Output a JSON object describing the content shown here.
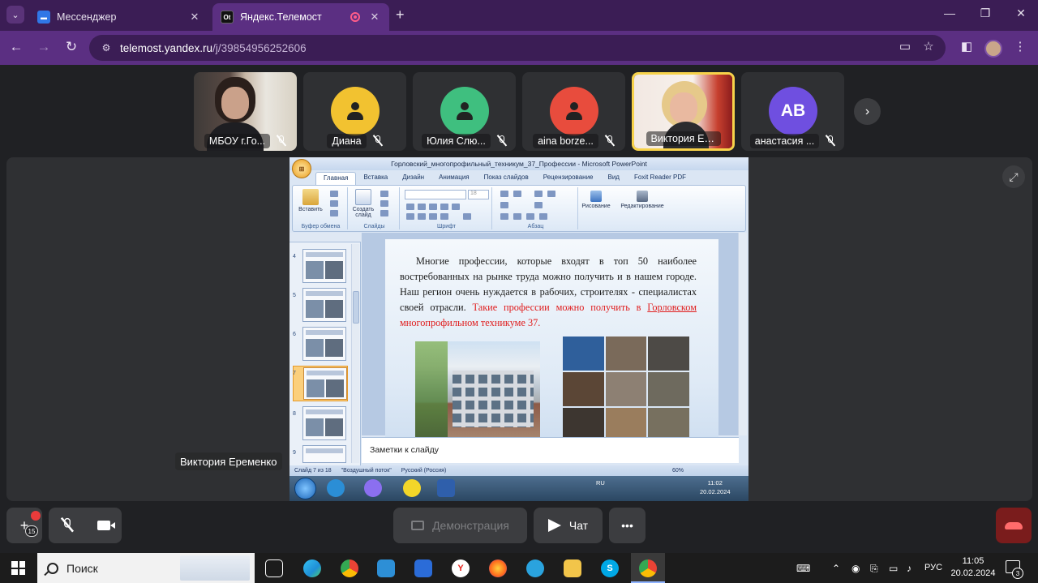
{
  "browser": {
    "tabs": [
      {
        "title": "Мессенджер",
        "active": false
      },
      {
        "title": "Яндекс.Телемост",
        "active": true
      }
    ],
    "url_host": "telemost.yandex.ru",
    "url_path": "/j/39854956252606"
  },
  "participants": [
    {
      "name": "МБОУ г.Го...",
      "kind": "video",
      "muted": true
    },
    {
      "name": "Диана",
      "kind": "avatar",
      "color": "#f2c230",
      "muted": true
    },
    {
      "name": "Юлия Слю...",
      "kind": "avatar",
      "color": "#3fbf7f",
      "muted": true
    },
    {
      "name": "aina borze...",
      "kind": "avatar",
      "color": "#e84c3d",
      "muted": true
    },
    {
      "name": "Виктория Ер...",
      "kind": "video",
      "speaking": true,
      "muted": false
    },
    {
      "name": "анастасия ...",
      "kind": "initials",
      "initials": "АВ",
      "color": "#6f4fe0",
      "muted": true
    }
  ],
  "presenter": "Виктория Еременко",
  "ppt": {
    "window_title": "Горловский_многопрофильный_техникум_37_Профессии - Microsoft PowerPoint",
    "ribbon_tabs": [
      "Главная",
      "Вставка",
      "Дизайн",
      "Анимация",
      "Показ слайдов",
      "Рецензирование",
      "Вид",
      "Foxit Reader PDF"
    ],
    "groups": {
      "clipboard": "Буфер обмена",
      "slides": "Слайды",
      "font": "Шрифт",
      "paragraph": "Абзац",
      "paste": "Вставить",
      "new_slide": "Создать слайд",
      "drawing": "Рисование",
      "editing": "Редактирование"
    },
    "thumb_numbers": [
      "4",
      "5",
      "6",
      "7",
      "8",
      "9"
    ],
    "slide_text_main": "Многие профессии, которые входят в топ 50 наиболее востребованных на рынке труда можно получить и в нашем городе. Наш регион очень нуждается в рабочих, строителях - специалистах своей отрасли. ",
    "slide_text_red_1": "Такие профессии можно получить в ",
    "slide_text_red_underlined": "Горловском",
    "slide_text_red_2": " многопрофильном техникуме 37.",
    "notes_placeholder": "Заметки к слайду",
    "status": {
      "slide_counter": "Слайд 7 из 18",
      "theme": "\"Воздушный поток\"",
      "language": "Русский (Россия)",
      "zoom": "60%"
    },
    "win7": {
      "lang": "RU",
      "time": "11:02",
      "date": "20.02.2024"
    }
  },
  "controls": {
    "participants_count": "15",
    "share_label": "Демонстрация",
    "chat_label": "Чат",
    "more_label": "•••"
  },
  "taskbar": {
    "search_label": "Поиск",
    "lang": "РУС",
    "time": "11:05",
    "date": "20.02.2024",
    "notifications": "3"
  }
}
